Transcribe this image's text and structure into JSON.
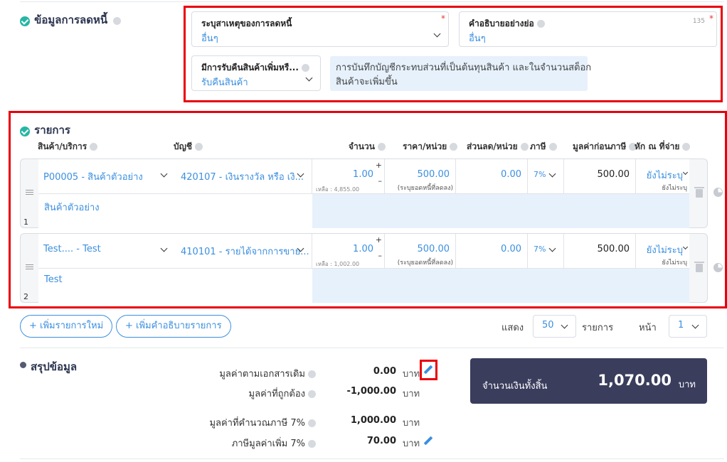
{
  "debt_section": {
    "title": "ข้อมูลการลดหนี้",
    "reason_label": "ระบุสาเหตุของการลดหนี้",
    "reason_value": "อื่นๆ",
    "desc_label": "คำอธิบายอย่างย่อ",
    "desc_value": "อื่นๆ",
    "desc_counter": "135",
    "return_label": "มีการรับคืนสินค้าเพิ่มหรื...",
    "return_value": "รับคืนสินค้า",
    "info_text_line1": "การบันทึกบัญชีกระทบส่วนที่เป็นต้นทุนสินค้า และในจำนวนสต็อก",
    "info_text_line2": "สินค้าจะเพิ่มขึ้น",
    "required_mark": "*"
  },
  "items_section": {
    "title": "รายการ",
    "columns": {
      "product": "สินค้า/บริการ",
      "account": "บัญชี",
      "qty": "จำนวน",
      "price": "ราคา/หน่วย",
      "discount": "ส่วนลด/หน่วย",
      "tax": "ภาษี",
      "pretax": "มูลค่าก่อนภาษี",
      "withholding": "หัก ณ ที่จ่าย"
    },
    "rows": [
      {
        "number": "1",
        "product": "P00005 - สินค้าตัวอย่าง",
        "account": "420107 - เงินรางวัล หรือ เงิ...",
        "qty": "1.00",
        "remaining": "เหลือ : 4,855.00",
        "price": "500.00",
        "price_note": "(ระบุยอดหนี้ที่ลดลง)",
        "discount": "0.00",
        "tax": "7%",
        "pretax": "500.00",
        "withholding": "ยังไม่ระบุ",
        "withholding_sub": "ยังไม่ระบุ",
        "description": "สินค้าตัวอย่าง"
      },
      {
        "number": "2",
        "product": "Test.... - Test",
        "account": "410101 - รายได้จากการขาย...",
        "qty": "1.00",
        "remaining": "เหลือ : 1,002.00",
        "price": "500.00",
        "price_note": "(ระบุยอดหนี้ที่ลดลง)",
        "discount": "0.00",
        "tax": "7%",
        "pretax": "500.00",
        "withholding": "ยังไม่ระบุ",
        "withholding_sub": "ยังไม่ระบุ",
        "description": "Test"
      }
    ],
    "plus": "+",
    "minus": "–"
  },
  "actions": {
    "add_item": "+ เพิ่มรายการใหม่",
    "add_desc": "+ เพิ่มคำอธิบายรายการ",
    "show_label": "แสดง",
    "show_value": "50",
    "items_label": "รายการ",
    "page_label": "หน้า",
    "page_value": "1"
  },
  "summary": {
    "title": "สรุปข้อมูล",
    "original_label": "มูลค่าตามเอกสารเดิม",
    "original_value": "0.00",
    "correct_label": "มูลค่าที่ถูกต้อง",
    "correct_value": "-1,000.00",
    "taxable_label": "มูลค่าที่คำนวณภาษี 7%",
    "taxable_value": "1,000.00",
    "vat_label": "ภาษีมูลค่าเพิ่ม 7%",
    "vat_value": "70.00",
    "unit": "บาท",
    "total_label": "จำนวนเงินทั้งสิ้น",
    "total_value": "1,070.00",
    "total_unit": "บาท"
  },
  "colors": {
    "accent": "#3b8fe0",
    "highlight": "#e8000b",
    "total_bg": "#3a3d5c",
    "check": "#26b6a5"
  }
}
